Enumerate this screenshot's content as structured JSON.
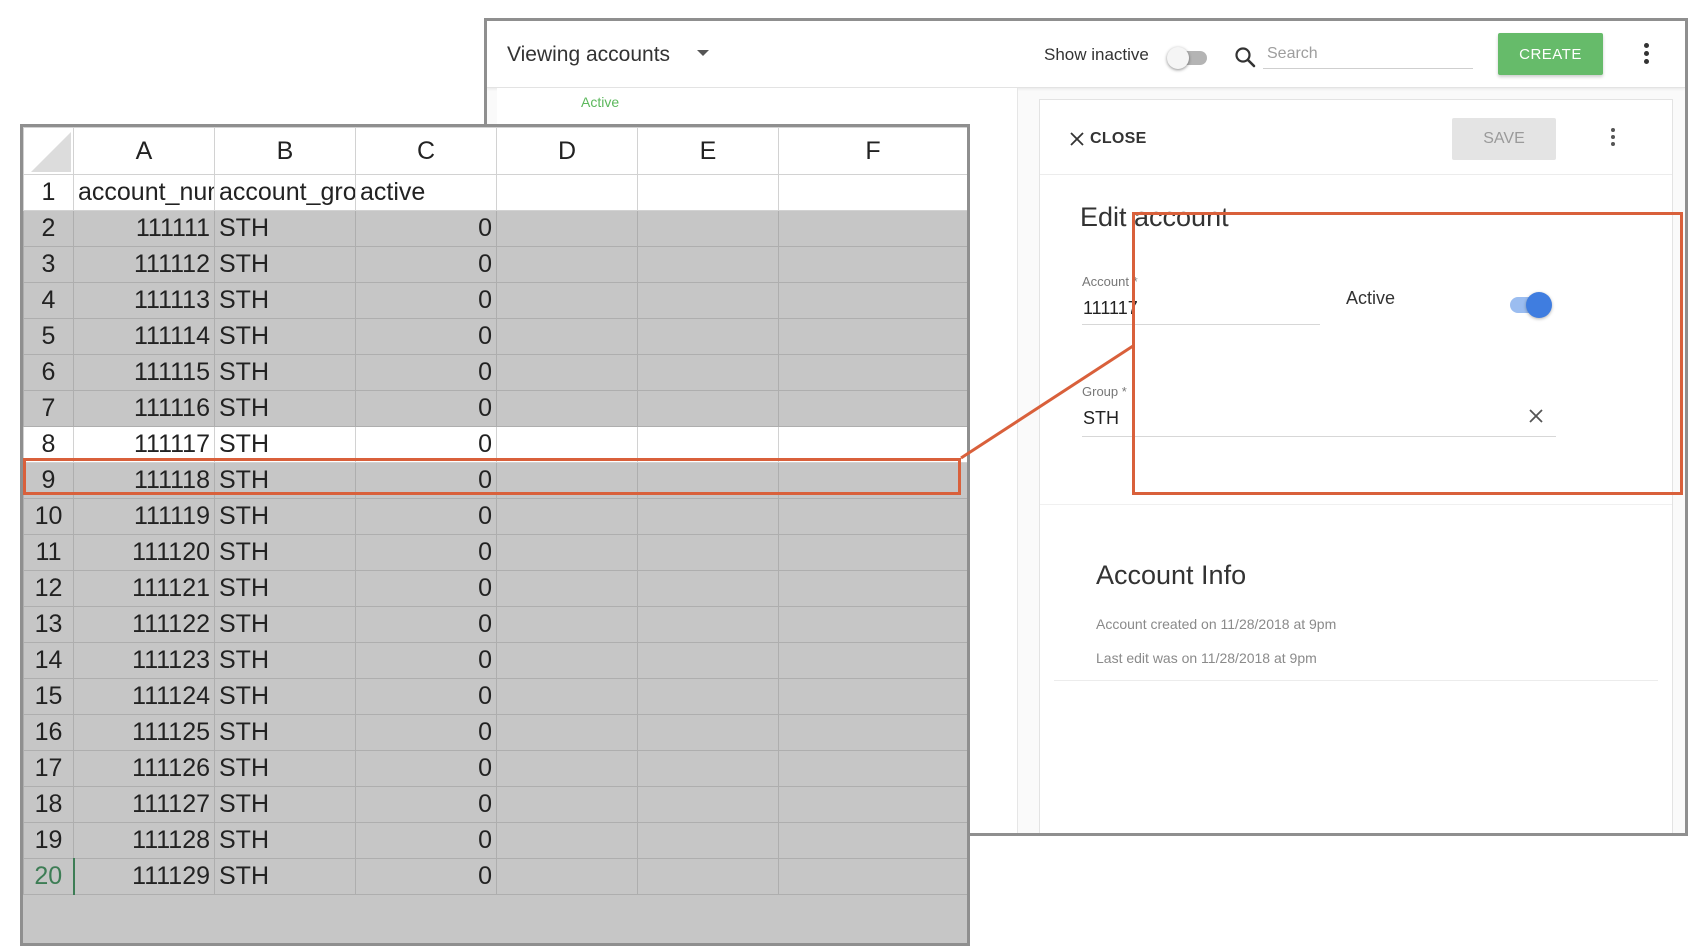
{
  "app": {
    "view_title": "Viewing accounts",
    "show_inactive_label": "Show inactive",
    "show_inactive_on": false,
    "search_placeholder": "Search",
    "search_value": "",
    "create_label": "CREATE",
    "list_status_label": "Active",
    "accent_green": "#66bb6a"
  },
  "panel": {
    "close_label": "CLOSE",
    "save_label": "SAVE",
    "edit_title": "Edit account",
    "account_label": "Account *",
    "account_value": "111117",
    "active_label": "Active",
    "active_on": true,
    "group_label": "Group *",
    "group_value": "STH",
    "info_title": "Account Info",
    "created_text": "Account created on 11/28/2018 at 9pm",
    "last_edit_text": "Last edit was on 11/28/2018 at 9pm"
  },
  "sheet": {
    "columns": [
      "A",
      "B",
      "C",
      "D",
      "E",
      "F"
    ],
    "header_cells": [
      "account_num",
      "account_group",
      "active"
    ],
    "rows": [
      {
        "row": "2",
        "a": "111111",
        "b": "STH",
        "c": "0"
      },
      {
        "row": "3",
        "a": "111112",
        "b": "STH",
        "c": "0"
      },
      {
        "row": "4",
        "a": "111113",
        "b": "STH",
        "c": "0"
      },
      {
        "row": "5",
        "a": "111114",
        "b": "STH",
        "c": "0"
      },
      {
        "row": "6",
        "a": "111115",
        "b": "STH",
        "c": "0"
      },
      {
        "row": "7",
        "a": "111116",
        "b": "STH",
        "c": "0"
      },
      {
        "row": "8",
        "a": "111117",
        "b": "STH",
        "c": "0"
      },
      {
        "row": "9",
        "a": "111118",
        "b": "STH",
        "c": "0"
      },
      {
        "row": "10",
        "a": "111119",
        "b": "STH",
        "c": "0"
      },
      {
        "row": "11",
        "a": "111120",
        "b": "STH",
        "c": "0"
      },
      {
        "row": "12",
        "a": "111121",
        "b": "STH",
        "c": "0"
      },
      {
        "row": "13",
        "a": "111122",
        "b": "STH",
        "c": "0"
      },
      {
        "row": "14",
        "a": "111123",
        "b": "STH",
        "c": "0"
      },
      {
        "row": "15",
        "a": "111124",
        "b": "STH",
        "c": "0"
      },
      {
        "row": "16",
        "a": "111125",
        "b": "STH",
        "c": "0"
      },
      {
        "row": "17",
        "a": "111126",
        "b": "STH",
        "c": "0"
      },
      {
        "row": "18",
        "a": "111127",
        "b": "STH",
        "c": "0"
      },
      {
        "row": "19",
        "a": "111128",
        "b": "STH",
        "c": "0"
      },
      {
        "row": "20",
        "a": "111129",
        "b": "STH",
        "c": "0"
      }
    ],
    "highlighted_row": "8",
    "highlight_color": "#d9603b"
  }
}
